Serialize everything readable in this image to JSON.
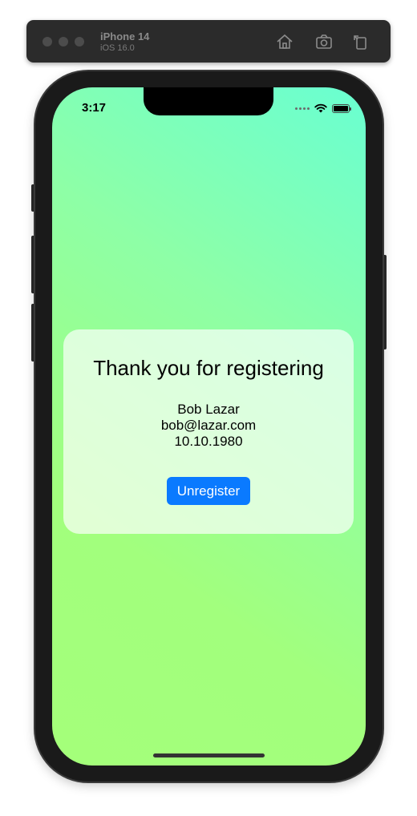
{
  "simulator": {
    "device_name": "iPhone 14",
    "os_version": "iOS 16.0",
    "toolbar_icons": [
      "home-icon",
      "screenshot-icon",
      "rotate-icon"
    ]
  },
  "status_bar": {
    "time": "3:17",
    "icons": [
      "signal-dots-icon",
      "wifi-icon",
      "battery-icon"
    ]
  },
  "card": {
    "title": "Thank you for registering",
    "name": "Bob Lazar",
    "email": "bob@lazar.com",
    "birthdate": "10.10.1980",
    "button_label": "Unregister"
  },
  "colors": {
    "button": "#0a7aff",
    "gradient_top": "#69ffd2",
    "gradient_bottom": "#a4ff7a"
  }
}
